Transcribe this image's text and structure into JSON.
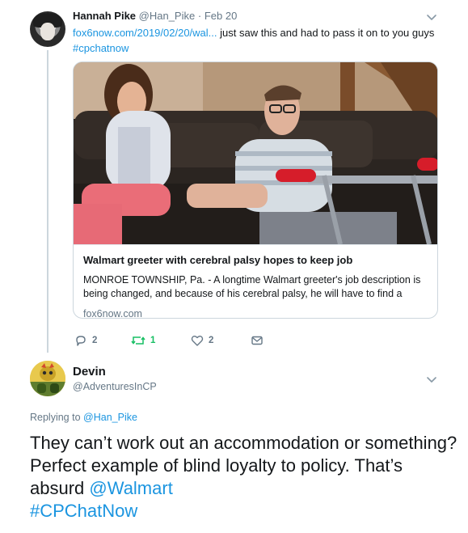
{
  "tweet1": {
    "name": "Hannah Pike",
    "handle": "@Han_Pike",
    "separator": "·",
    "date": "Feb 20",
    "link_text": "fox6now.com/2019/02/20/wal...",
    "text": "just saw this and had to pass it on to you guys",
    "hashtag": "#cpchatnow",
    "card": {
      "title": "Walmart greeter with cerebral palsy hopes to keep job",
      "description": "MONROE TOWNSHIP, Pa. - A longtime Walmart greeter's job description is being changed, and because of his cerebral palsy, he will have to find a",
      "domain": "fox6now.com"
    },
    "actions": {
      "replies": "2",
      "retweets": "1",
      "likes": "2"
    }
  },
  "tweet2": {
    "name": "Devin",
    "handle": "@AdventuresInCP",
    "replying_label": "Replying to",
    "replying_handle": "@Han_Pike",
    "text": "They can’t work out an accommodation or something? Perfect example of blind loyalty to policy. That’s absurd",
    "mention": "@Walmart",
    "hashtag": "#CPChatNow"
  },
  "colors": {
    "link": "#1b95e0",
    "secondary": "#657786",
    "retweet": "#17bf63",
    "border": "#ccd6dd"
  },
  "icons": [
    "chevron-down-icon",
    "reply-icon",
    "retweet-icon",
    "like-icon",
    "dm-icon"
  ]
}
